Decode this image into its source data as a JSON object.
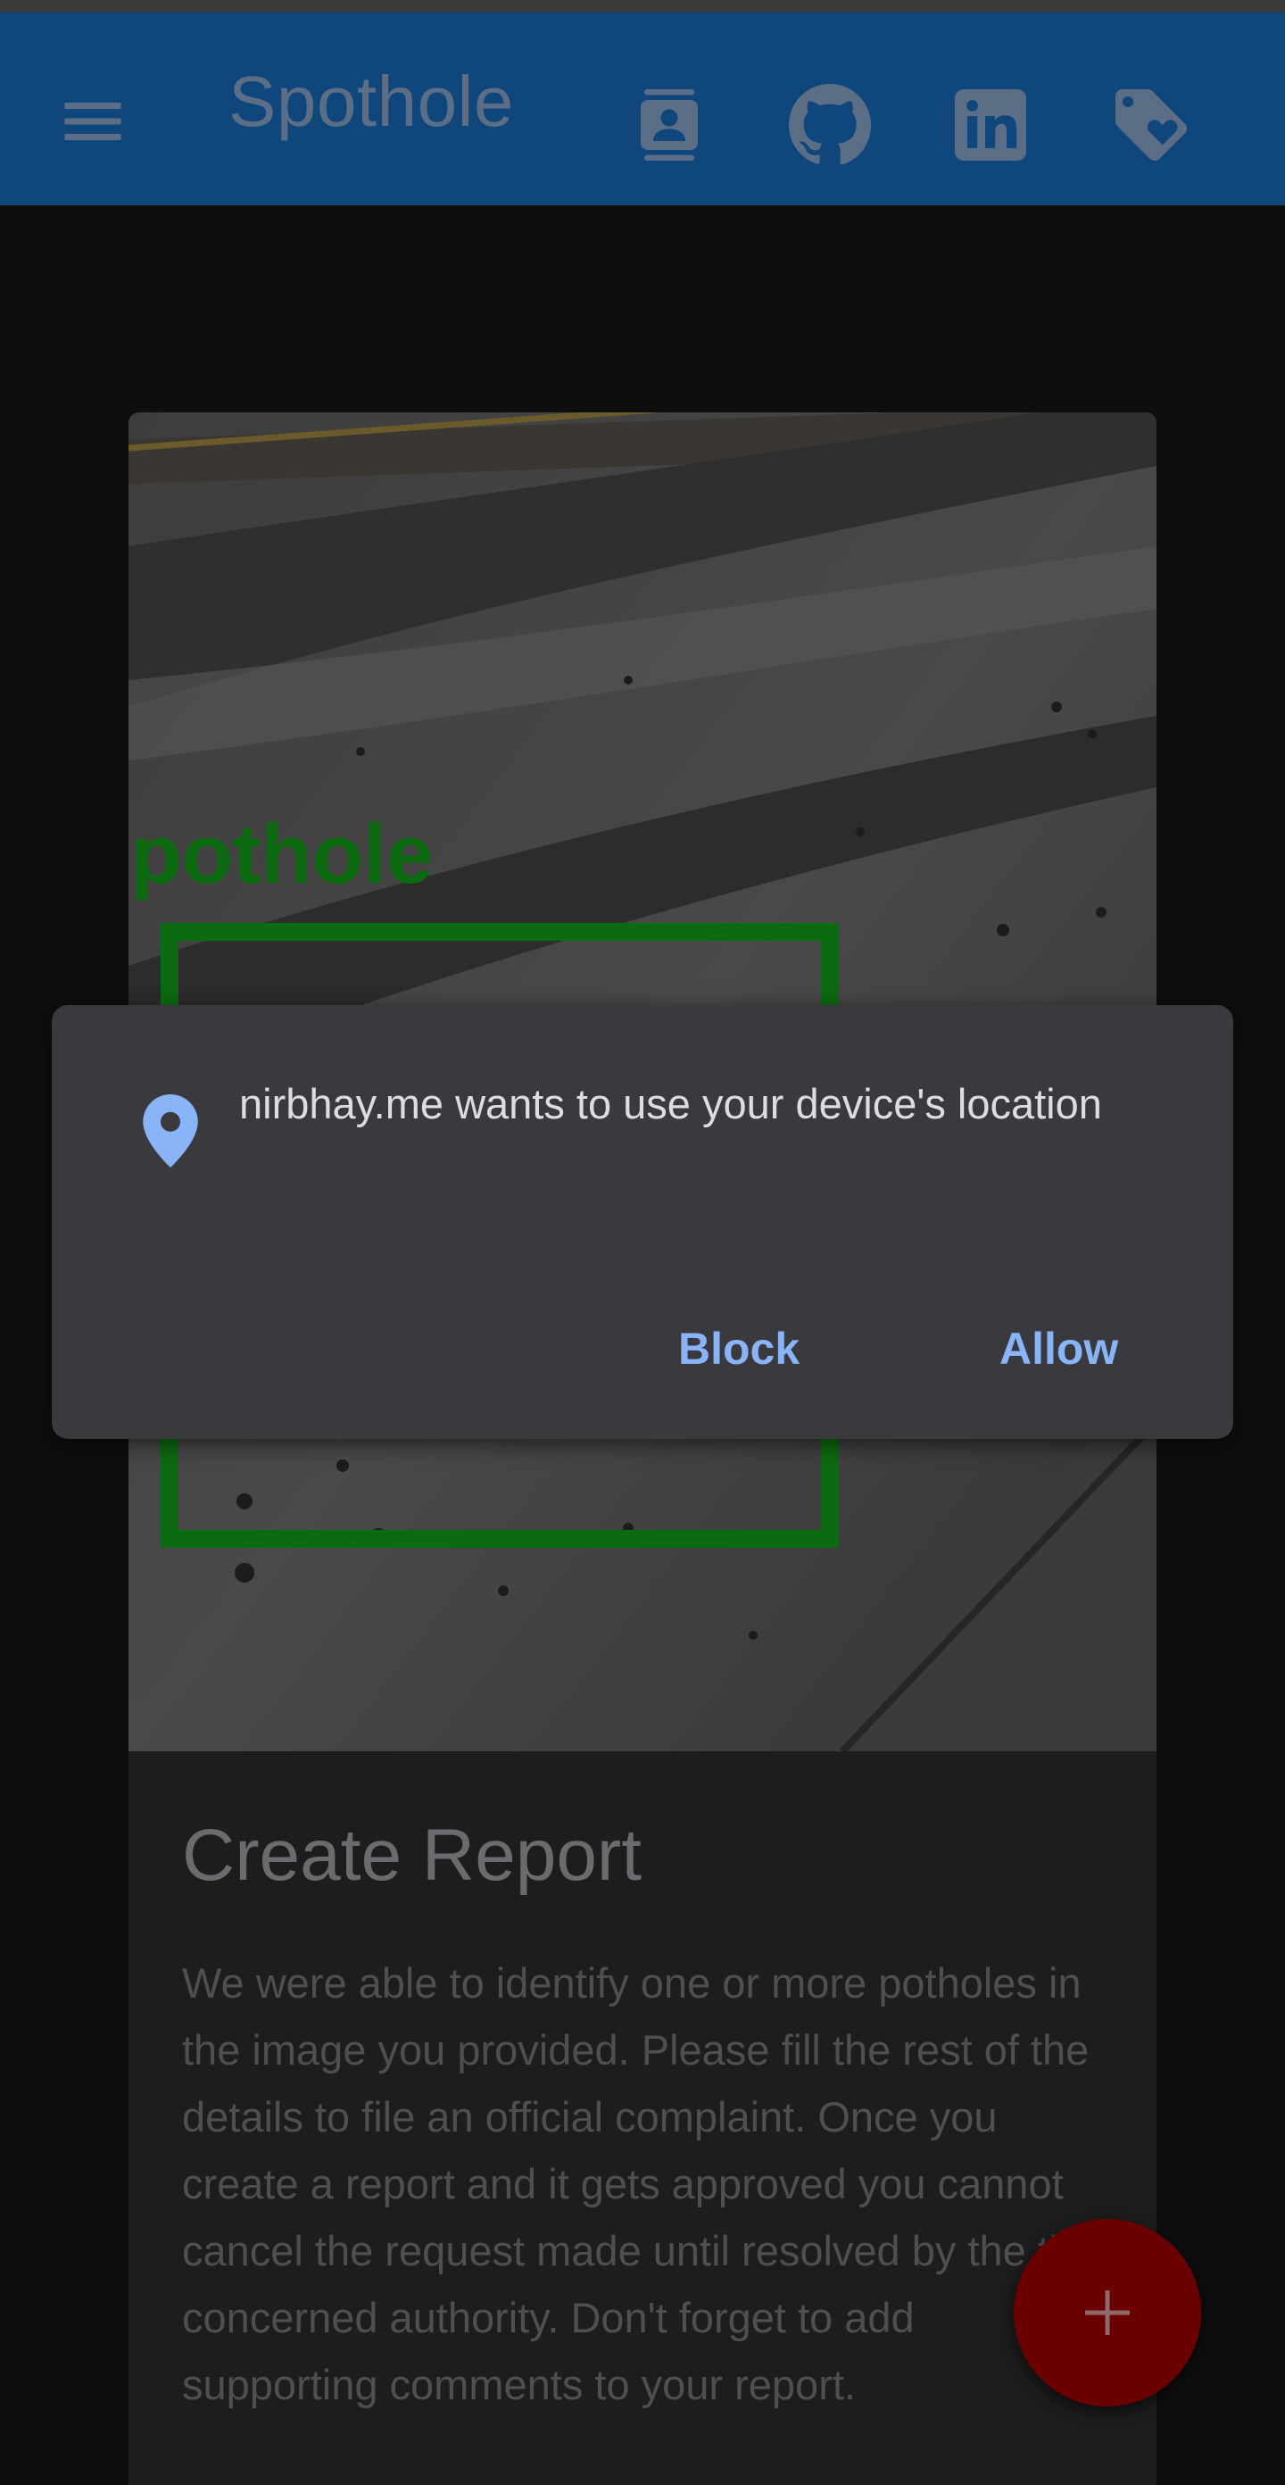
{
  "app_bar": {
    "title": "Spothole",
    "icons": [
      "menu-icon",
      "contact-icon",
      "github-icon",
      "linkedin-icon",
      "tag-heart-icon"
    ]
  },
  "card": {
    "image_label": "pothole",
    "heading": "Create Report",
    "body": "We were able to identify one or more potholes in the image you provided. Please fill the rest of the details to file an official complaint. Once you create a report and it gets approved you cannot cancel the request made until resolved by the the concerned authority. Don't forget to add supporting comments to your report."
  },
  "permission_dialog": {
    "message": "nirbhay.me wants to use your device's location",
    "block_label": "Block",
    "allow_label": "Allow",
    "icon": "location-pin-icon"
  },
  "fab": {
    "icon": "plus-icon"
  },
  "colors": {
    "app_bar": "#0f467c",
    "background": "#0e0e0f",
    "dialog": "#39393e",
    "dialog_button": "#8ab4f8",
    "pin": "#8ab4f8",
    "detection_box": "#0c6a10",
    "fab": "#6b0000"
  }
}
